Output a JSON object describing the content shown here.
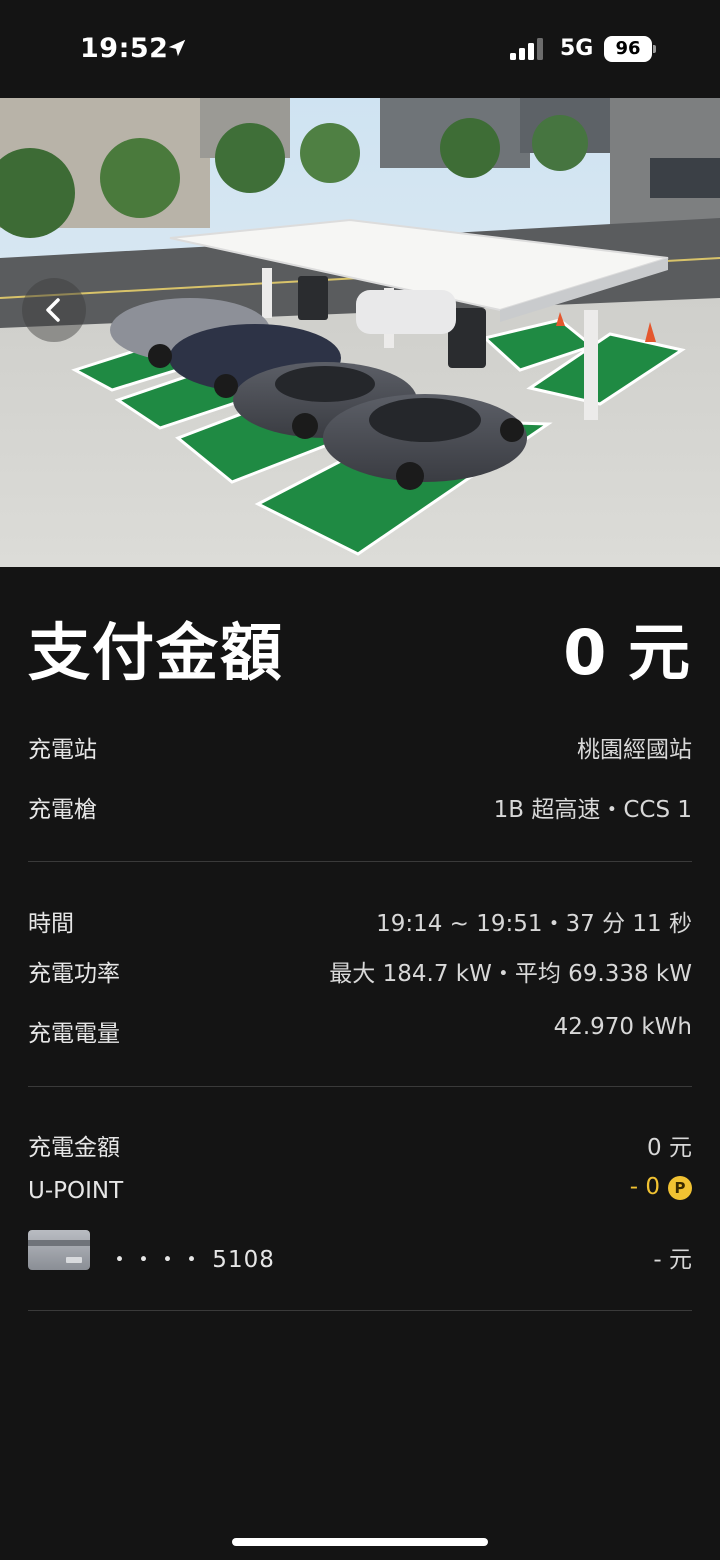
{
  "status_bar": {
    "time": "19:52",
    "network": "5G",
    "battery": "96"
  },
  "hero": {
    "image_icon": "photo-charging-station",
    "back_icon": "chevron-left-icon"
  },
  "payment": {
    "title": "支付金額",
    "total": "0 元"
  },
  "station": {
    "station_label": "充電站",
    "station_value": "桃園經國站",
    "gun_label": "充電槍",
    "gun_value": "1B 超高速・CCS 1"
  },
  "session": {
    "time_label": "時間",
    "time_value": "19:14 ~ 19:51・37 分 11 秒",
    "power_label": "充電功率",
    "power_value": "最大 184.7 kW・平均 69.338 kW",
    "energy_label": "充電電量",
    "energy_value": "42.970 kWh"
  },
  "billing": {
    "charge_label": "充電金額",
    "charge_value": "0 元",
    "upoint_label": "U-POINT",
    "upoint_value": "- 0",
    "upoint_badge": "P",
    "card_number": "・・・・ 5108",
    "card_value": "- 元"
  },
  "colors": {
    "background": "#141414",
    "accent_gold": "#f1c232",
    "parking_green": "#1f8a43"
  }
}
